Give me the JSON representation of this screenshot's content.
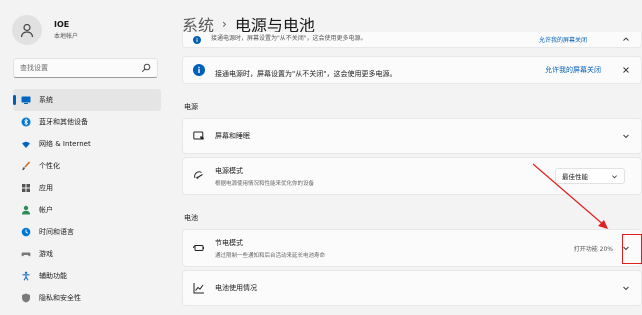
{
  "user": {
    "name": "IOE",
    "account": "本地帐户"
  },
  "search": {
    "placeholder": "查找设置"
  },
  "nav": [
    {
      "label": "系统",
      "icon": "monitor-icon",
      "color": "#0067c0",
      "active": true
    },
    {
      "label": "蓝牙和其他设备",
      "icon": "bluetooth-icon",
      "color": "#0078d4"
    },
    {
      "label": "网络 & Internet",
      "icon": "wifi-icon",
      "color": "#0067c0"
    },
    {
      "label": "个性化",
      "icon": "brush-icon",
      "color": "#d2691e"
    },
    {
      "label": "应用",
      "icon": "apps-icon",
      "color": "#555555"
    },
    {
      "label": "帐户",
      "icon": "person-icon",
      "color": "#2e8b57"
    },
    {
      "label": "时间和语言",
      "icon": "globe-clock-icon",
      "color": "#0078d4"
    },
    {
      "label": "游戏",
      "icon": "gamepad-icon",
      "color": "#7a7a7a"
    },
    {
      "label": "辅助功能",
      "icon": "accessibility-icon",
      "color": "#1a6fd1"
    },
    {
      "label": "隐私和安全性",
      "icon": "shield-icon",
      "color": "#7a7a7a"
    }
  ],
  "breadcrumb": {
    "parent": "系统",
    "separator": "›",
    "current": "电源与电池"
  },
  "info_partial": {
    "text": "接通电源时，屏幕设置为\"从不关闭\"，这会使用更多电源。",
    "link": "允许我的屏幕关闭"
  },
  "info": {
    "text": "接通电源时，屏幕设置为\"从不关闭\"，这会使用更多电源。",
    "link": "允许我的屏幕关闭"
  },
  "sections": {
    "power": "电源",
    "battery": "电池"
  },
  "screen_sleep": {
    "label": "屏幕和睡眠"
  },
  "power_mode": {
    "label": "电源模式",
    "desc": "根据电源使用情况和性能来优化你的设备",
    "value": "最佳性能"
  },
  "battery_saver": {
    "label": "节电模式",
    "desc": "通过限制一些通知和后台活动来延长电池寿命",
    "status": "打开功能 20%"
  },
  "battery_usage": {
    "label": "电池使用情况"
  },
  "colors": {
    "accent": "#005fb8",
    "highlight": "#e02020"
  }
}
